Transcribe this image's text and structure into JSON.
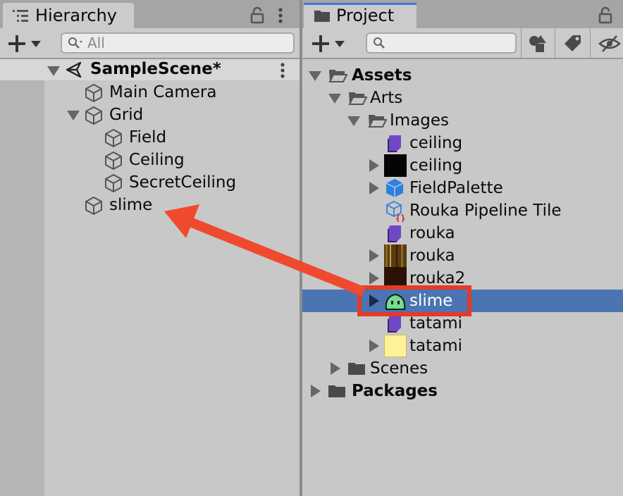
{
  "hierarchy": {
    "tab_title": "Hierarchy",
    "search_placeholder": "All",
    "scene_name": "SampleScene*",
    "items": [
      {
        "label": "Main Camera"
      },
      {
        "label": "Grid"
      },
      {
        "label": "Field"
      },
      {
        "label": "Ceiling"
      },
      {
        "label": "SecretCeiling"
      },
      {
        "label": "slime"
      }
    ]
  },
  "project": {
    "tab_title": "Project",
    "search_placeholder": "",
    "tree": [
      {
        "label": "Assets"
      },
      {
        "label": "Arts"
      },
      {
        "label": "Images"
      },
      {
        "label": "ceiling"
      },
      {
        "label": "ceiling"
      },
      {
        "label": "FieldPalette"
      },
      {
        "label": "Rouka Pipeline Tile"
      },
      {
        "label": "rouka"
      },
      {
        "label": "rouka"
      },
      {
        "label": "rouka2"
      },
      {
        "label": "slime"
      },
      {
        "label": "tatami"
      },
      {
        "label": "tatami"
      },
      {
        "label": "Scenes"
      },
      {
        "label": "Packages"
      }
    ],
    "selected_item": "slime"
  },
  "colors": {
    "selection": "#4b74b2",
    "highlight_box": "#e43b25",
    "arrow": "#f04a2e",
    "material_purple": "#7048c2",
    "palette_blue": "#2f7fdc",
    "tatami_yellow": "#fdf29a",
    "slime_green": "#6fe08a"
  },
  "icons": [
    "hierarchy-list-icon",
    "lock-icon",
    "kebab-menu-icon",
    "plus-icon",
    "search-icon",
    "unity-scene-icon",
    "cube-icon",
    "folder-icon",
    "folder-open-icon",
    "material-icon",
    "prefab-icon",
    "tile-icon",
    "filter-type-icon",
    "label-tag-icon",
    "visibility-icon"
  ]
}
